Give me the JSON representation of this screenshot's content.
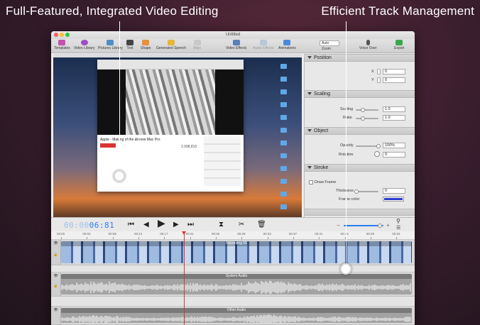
{
  "headlines": {
    "left": "Full-Featured, Integrated Video Editing",
    "right": "Efficient Track Management"
  },
  "window": {
    "title": "Untitled"
  },
  "toolbar": {
    "templates": "Templates",
    "video_library": "Video Library",
    "pictures_library": "Pictures Library",
    "text": "Text",
    "shape": "Shape",
    "generated_speech": "Generated Speech",
    "align": "Align",
    "video_effects": "Video Effects",
    "audio_effects": "Audio Effects",
    "animations": "Animations",
    "zoom_value": "Auto",
    "zoom": "Zoom",
    "voice_over": "Voice Over",
    "export": "Export"
  },
  "inspector": {
    "position": {
      "title": "Position",
      "x_label": "X",
      "x_value": "0",
      "y_label": "Y",
      "y_value": "0"
    },
    "scaling": {
      "title": "Scaling",
      "scaling_label": "Scaling",
      "scaling_value": "1.0",
      "ratio_label": "Ratio",
      "ratio_value": "1.0",
      "scaling_level": 0.3,
      "ratio_level": 0.3
    },
    "object": {
      "title": "Object",
      "opacity_label": "Opacity",
      "opacity_value": "100%",
      "opacity_level": 1.0,
      "rotation_label": "Rotation",
      "rotation_value": "0"
    },
    "stroke": {
      "title": "Stroke",
      "draw_frame_label": "Draw Frame",
      "draw_frame_checked": false,
      "thickness_label": "Thickness",
      "thickness_value": "0",
      "frame_color_label": "Frame color",
      "frame_color": "#2a3ccf"
    }
  },
  "transport": {
    "timecode_dim": "00:00",
    "timecode": "06:81"
  },
  "ruler": {
    "ticks": [
      "00:00",
      "00:04",
      "00:08",
      "00:12",
      "00:17",
      "00:21",
      "00:25",
      "00:29",
      "00:33",
      "00:37",
      "00:41",
      "00:45",
      "00:49",
      "00:53"
    ]
  },
  "tracks": {
    "video": "Recording 65",
    "system_audio": "System Audio",
    "other_audio": "Other Audio"
  },
  "screen": {
    "video_title": "Apple - Making of the all-new Mac Pro",
    "views": "2,998,810"
  },
  "colors": {
    "accent_blue": "#2f7cf0",
    "playhead": "#e03030"
  }
}
